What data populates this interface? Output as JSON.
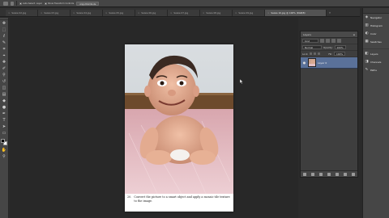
{
  "options_bar": {
    "items": [
      {
        "icon": "move-tool-icon"
      },
      {
        "icon": "tool-preset-icon"
      },
      {
        "checkbox_label": "Auto-Select: Layer"
      },
      {
        "checkbox_label": "Show Transform Controls"
      },
      {
        "button_label": "Align/Distribute"
      }
    ]
  },
  "tabs": [
    {
      "label": "Saisie 02.jpg",
      "active": false
    },
    {
      "label": "Saisie 03.jpg",
      "active": false
    },
    {
      "label": "Saisie 04.jpg",
      "active": false
    },
    {
      "label": "Saisie 05.jpg",
      "active": false
    },
    {
      "label": "Saisie 06.jpg",
      "active": false
    },
    {
      "label": "Saisie 07.jpg",
      "active": false
    },
    {
      "label": "Saisie 08.jpg",
      "active": false
    },
    {
      "label": "Saisie 09.jpg",
      "active": false
    },
    {
      "label": "Saisie 10.jpg @ 100% (RGB/8)",
      "active": true
    }
  ],
  "tabs_close_glyph": "×",
  "tabs_more_glyph": "»",
  "tools": [
    {
      "name": "move-tool-icon",
      "glyph": "✥"
    },
    {
      "name": "marquee-tool-icon",
      "glyph": "⬚"
    },
    {
      "name": "lasso-tool-icon",
      "glyph": "ℓ"
    },
    {
      "name": "quick-select-tool-icon",
      "glyph": "✎"
    },
    {
      "name": "crop-tool-icon",
      "glyph": "⌗"
    },
    {
      "name": "eyedropper-tool-icon",
      "glyph": "⌖"
    },
    {
      "name": "healing-brush-tool-icon",
      "glyph": "✚"
    },
    {
      "name": "brush-tool-icon",
      "glyph": "✐"
    },
    {
      "name": "clone-stamp-tool-icon",
      "glyph": "⚲"
    },
    {
      "name": "history-brush-tool-icon",
      "glyph": "↺"
    },
    {
      "name": "eraser-tool-icon",
      "glyph": "◫"
    },
    {
      "name": "gradient-tool-icon",
      "glyph": "▤"
    },
    {
      "name": "blur-tool-icon",
      "glyph": "◆"
    },
    {
      "name": "dodge-tool-icon",
      "glyph": "●"
    },
    {
      "name": "pen-tool-icon",
      "glyph": "✒"
    },
    {
      "name": "type-tool-icon",
      "glyph": "T"
    },
    {
      "name": "path-select-tool-icon",
      "glyph": "➤"
    },
    {
      "name": "shape-tool-icon",
      "glyph": "▭"
    },
    {
      "name": "hand-tool-icon",
      "glyph": "✋"
    },
    {
      "name": "zoom-tool-icon",
      "glyph": "⚲"
    }
  ],
  "colors": {
    "foreground": "#000000",
    "background": "#ffffff",
    "layer_selected": "#5a7199"
  },
  "document": {
    "caption_number": "20.",
    "caption_text": "Convert the picture to a smart object and apply a mosaic tile texture to the image."
  },
  "layers_panel": {
    "title": "Layers",
    "close_glyph": "≡",
    "kind_label": "Kind",
    "blend_mode": "Normal",
    "opacity_label": "Opacity:",
    "opacity_value": "100%",
    "lock_label": "Lock:",
    "fill_label": "Fill:",
    "fill_value": "100%",
    "layer_name": "Layer 0",
    "eye_glyph": "●"
  },
  "dock": {
    "items": [
      {
        "name": "navigator-icon",
        "glyph": "◈",
        "label": "Navigator"
      },
      {
        "name": "histogram-icon",
        "glyph": "▥",
        "label": "Histogram"
      },
      {
        "name": "color-icon",
        "glyph": "◐",
        "label": "Color"
      },
      {
        "name": "swatches-icon",
        "glyph": "▦",
        "label": "Swatches"
      },
      {
        "name": "layers-icon",
        "glyph": "◧",
        "label": "Layers"
      },
      {
        "name": "channels-icon",
        "glyph": "◨",
        "label": "Channels"
      },
      {
        "name": "paths-icon",
        "glyph": "✎",
        "label": "Paths"
      }
    ]
  }
}
